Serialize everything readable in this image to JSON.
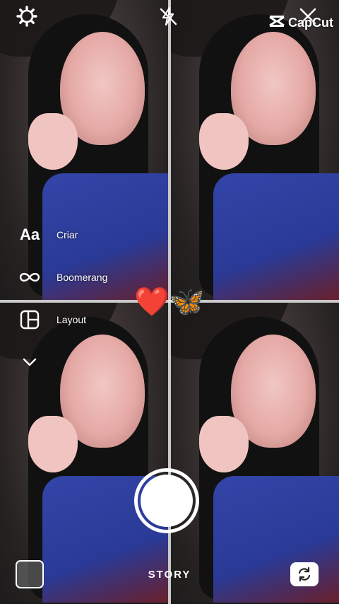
{
  "watermark": {
    "text": "CapCut",
    "icon": "capcut-logo-icon"
  },
  "top_bar": {
    "settings_icon": "gear-icon",
    "flash_icon": "flash-off-icon",
    "close_icon": "close-icon"
  },
  "side_menu": {
    "items": [
      {
        "icon_text": "Aa",
        "label": "Criar",
        "icon": "text-icon"
      },
      {
        "label": "Boomerang",
        "icon": "infinity-icon"
      },
      {
        "label": "Layout",
        "icon": "layout-grid-icon"
      }
    ],
    "more_icon": "chevron-down-icon"
  },
  "sticker": {
    "emoji": "❤️🦋"
  },
  "bottom_bar": {
    "mode_label": "STORY",
    "gallery_icon": "gallery-thumbnail",
    "flip_icon": "camera-flip-icon"
  }
}
